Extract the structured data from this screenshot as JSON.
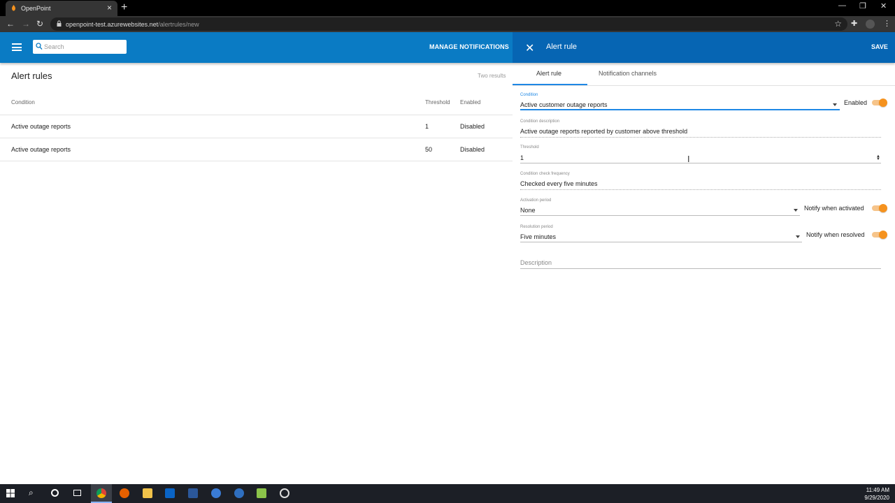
{
  "browser": {
    "tab_title": "OpenPoint",
    "url_host": "openpoint-test.azurewebsites.net",
    "url_path": "/alertrules/new"
  },
  "header": {
    "search_placeholder": "Search",
    "manage_notifications": "MANAGE NOTIFICATIONS"
  },
  "list": {
    "title": "Alert rules",
    "results": "Two results",
    "columns": {
      "condition": "Condition",
      "threshold": "Threshold",
      "enabled": "Enabled"
    },
    "rows": [
      {
        "condition": "Active outage reports",
        "threshold": "1",
        "enabled": "Disabled"
      },
      {
        "condition": "Active outage reports",
        "threshold": "50",
        "enabled": "Disabled"
      }
    ]
  },
  "panel": {
    "title": "Alert rule",
    "save": "SAVE",
    "tabs": [
      "Alert rule",
      "Notification channels"
    ],
    "condition": {
      "label": "Condition",
      "value": "Active customer outage reports"
    },
    "enabled": {
      "label": "Enabled",
      "on": true
    },
    "condition_description": {
      "label": "Condition description",
      "value": "Active outage reports reported by customer above threshold"
    },
    "threshold": {
      "label": "Threshold",
      "value": "1"
    },
    "check_frequency": {
      "label": "Condition check frequency",
      "value": "Checked every five minutes"
    },
    "activation_period": {
      "label": "Activation period",
      "value": "None"
    },
    "notify_activated": {
      "label": "Notify when activated",
      "on": true
    },
    "resolution_period": {
      "label": "Resolution period",
      "value": "Five minutes"
    },
    "notify_resolved": {
      "label": "Notify when resolved",
      "on": true
    },
    "description": {
      "placeholder": "Description"
    }
  },
  "taskbar": {
    "time": "11:49 AM",
    "date": "9/29/2020"
  },
  "colors": {
    "app_header": "#0a7bc4",
    "panel_header": "#0665b3",
    "toggle_accent": "#f5921e",
    "tab_indicator": "#1e88e5"
  }
}
